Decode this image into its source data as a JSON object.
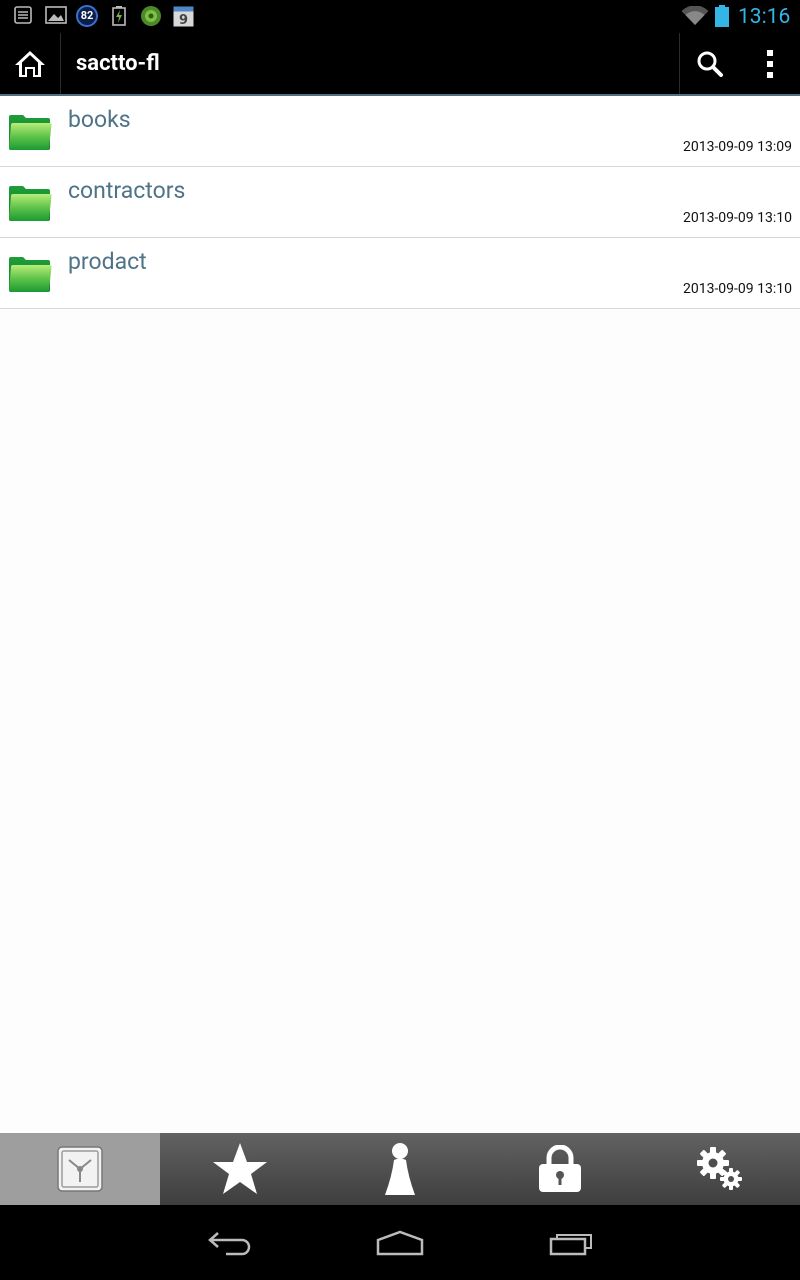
{
  "status_bar": {
    "badge_count": "82",
    "calendar_day": "9",
    "time": "13:16",
    "accent_color": "#33b5e5"
  },
  "action_bar": {
    "title": "sactto-fl",
    "home_icon": "home-icon",
    "search_icon": "search-icon",
    "overflow_icon": "overflow-menu-icon"
  },
  "files": [
    {
      "name": "books",
      "date": "2013-09-09 13:09",
      "icon": "folder-icon"
    },
    {
      "name": "contractors",
      "date": "2013-09-09 13:10",
      "icon": "folder-icon"
    },
    {
      "name": "prodact",
      "date": "2013-09-09 13:10",
      "icon": "folder-icon"
    }
  ],
  "tabs": [
    {
      "id": "storage",
      "icon": "storage-icon",
      "active": true
    },
    {
      "id": "favorites",
      "icon": "star-icon",
      "active": false
    },
    {
      "id": "account",
      "icon": "person-icon",
      "active": false
    },
    {
      "id": "lock",
      "icon": "lock-icon",
      "active": false
    },
    {
      "id": "settings",
      "icon": "gear-icon",
      "active": false
    }
  ],
  "nav": {
    "back_icon": "back-icon",
    "home_icon": "nav-home-icon",
    "recents_icon": "recents-icon"
  }
}
